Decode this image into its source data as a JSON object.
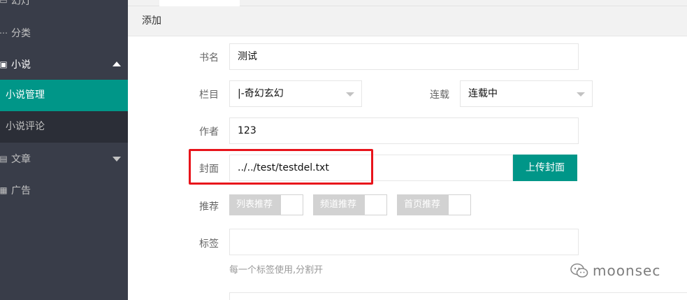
{
  "sidebar": {
    "items": [
      {
        "label": "幻灯",
        "icon": "slides-icon"
      },
      {
        "label": "分类",
        "icon": "category-icon"
      },
      {
        "label": "小说",
        "icon": "book-icon"
      },
      {
        "label": "文章",
        "icon": "article-icon"
      },
      {
        "label": "广告",
        "icon": "ad-icon"
      }
    ],
    "subitems": [
      {
        "label": "小说管理",
        "active": true
      },
      {
        "label": "小说评论",
        "active": false
      }
    ]
  },
  "panel": {
    "title": "添加"
  },
  "form": {
    "name_label": "书名",
    "name_value": "测试",
    "column_label": "栏目",
    "column_value": "|-奇幻玄幻",
    "serial_label": "连载",
    "serial_value": "连载中",
    "author_label": "作者",
    "author_value": "123",
    "cover_label": "封面",
    "cover_value": "../../test/testdel.txt",
    "upload_button": "上传封面",
    "recommend_label": "推荐",
    "recommend_switches": [
      "列表推荐",
      "频道推荐",
      "首页推荐"
    ],
    "tags_label": "标签",
    "tags_value": "",
    "tags_hint": "每一个标签使用,分割开"
  },
  "watermark": {
    "text": "moonsec",
    "icon": "wechat-icon"
  },
  "colors": {
    "accent": "#009688",
    "sidebar_bg": "#393d49",
    "highlight_box": "#e8141b"
  }
}
